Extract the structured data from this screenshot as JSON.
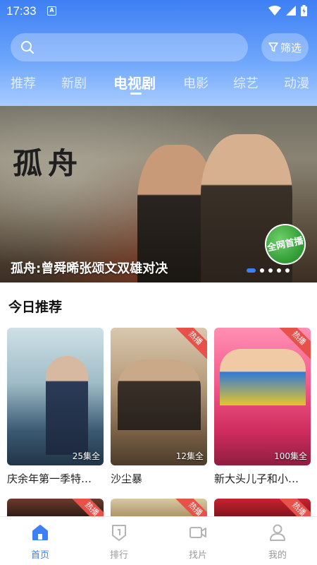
{
  "status": {
    "time": "17:33",
    "indicator": "A"
  },
  "search": {
    "placeholder": "",
    "filter_label": "筛选"
  },
  "tabs": [
    {
      "label": "推荐"
    },
    {
      "label": "新剧"
    },
    {
      "label": "电视剧",
      "active": true
    },
    {
      "label": "电影"
    },
    {
      "label": "综艺"
    },
    {
      "label": "动漫"
    }
  ],
  "banner": {
    "calligraphy": "孤舟",
    "badge": "全网首播",
    "caption": "孤舟:曾舜晞张颂文双雄对决",
    "slide_count": 5,
    "active_slide": 1
  },
  "section": {
    "title": "今日推荐"
  },
  "cards": [
    {
      "title": "庆余年第一季特…",
      "episodes": "25集全",
      "hot": false,
      "hot_label": ""
    },
    {
      "title": "沙尘暴",
      "episodes": "12集全",
      "hot": true,
      "hot_label": "热播"
    },
    {
      "title": "新大头儿子和小…",
      "episodes": "100集全",
      "hot": true,
      "hot_label": "热播"
    }
  ],
  "second_row": [
    {
      "hot_label": "热播"
    },
    {
      "hot_label": "热播"
    },
    {
      "hot_label": "热播"
    }
  ],
  "nav": [
    {
      "label": "首页",
      "icon": "home-icon",
      "active": true
    },
    {
      "label": "排行",
      "icon": "ranking-icon"
    },
    {
      "label": "找片",
      "icon": "video-camera-icon"
    },
    {
      "label": "我的",
      "icon": "user-icon"
    }
  ],
  "colors": {
    "accent": "#3d7ff4",
    "hot": "#e8514a"
  }
}
